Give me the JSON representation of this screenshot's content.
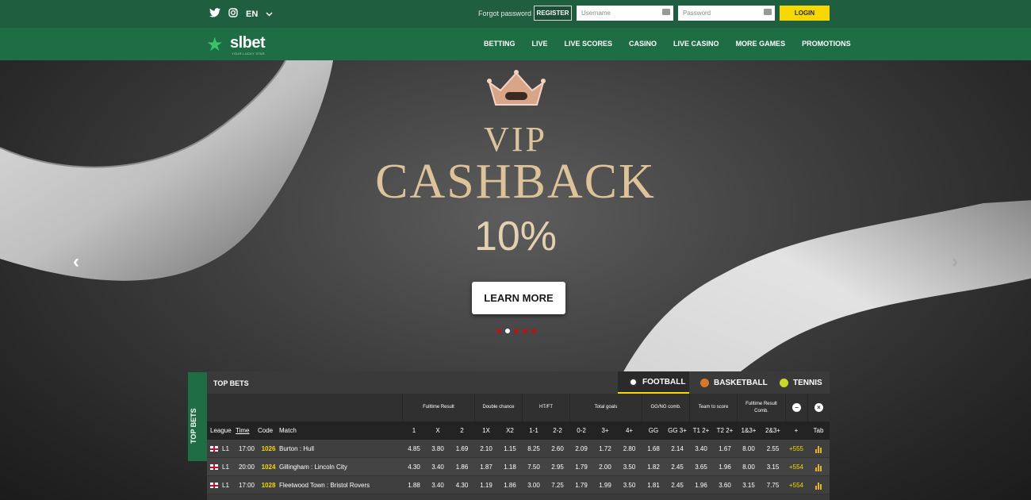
{
  "header": {
    "language": "EN",
    "forgot_password": "Forgot password",
    "register_label": "REGISTER",
    "username_placeholder": "Username",
    "password_placeholder": "Password",
    "login_label": "LOGIN"
  },
  "brand": {
    "name": "slbet",
    "tagline": "YOUR LUCKY STAR"
  },
  "nav": [
    "BETTING",
    "LIVE",
    "LIVE SCORES",
    "CASINO",
    "LIVE CASINO",
    "MORE GAMES",
    "PROMOTIONS"
  ],
  "banner": {
    "line1": "VIP",
    "line2": "CASHBACK",
    "line3": "10%",
    "cta": "LEARN MORE",
    "slides": 5,
    "active_slide": 1
  },
  "top_bets": {
    "side_label": "TOP BETS",
    "title": "TOP BETS",
    "sports": [
      {
        "label": "FOOTBALL",
        "icon": "football-icon",
        "active": true
      },
      {
        "label": "BASKETBALL",
        "icon": "basketball-icon",
        "active": false
      },
      {
        "label": "TENNIS",
        "icon": "tennis-icon",
        "active": false
      }
    ],
    "groups": [
      "Fulltime Result",
      "Double chance",
      "HT/FT",
      "Total goals",
      "GG/NG comb.",
      "Team to score",
      "Fulltime Result Comb."
    ],
    "columns": [
      "League",
      "Time",
      "Code",
      "Match",
      "1",
      "X",
      "2",
      "1X",
      "X2",
      "1-1",
      "2-2",
      "0-2",
      "3+",
      "4+",
      "GG",
      "GG 3+",
      "T1 2+",
      "T2 2+",
      "1&3+",
      "2&3+",
      "+",
      "Tab"
    ],
    "rows": [
      {
        "league": "L1",
        "time": "17:00",
        "code": "1026",
        "match": "Burton : Hull",
        "odds": [
          "4.85",
          "3.80",
          "1.69",
          "2.10",
          "1.15",
          "8.25",
          "2.60",
          "2.09",
          "1.72",
          "2.80",
          "1.68",
          "2.14",
          "3.40",
          "1.67",
          "8.00",
          "2.55"
        ],
        "more": "+555"
      },
      {
        "league": "L1",
        "time": "20:00",
        "code": "1024",
        "match": "Gillingham : Lincoln City",
        "odds": [
          "4.30",
          "3.40",
          "1.86",
          "1.87",
          "1.18",
          "7.50",
          "2.95",
          "1.79",
          "2.00",
          "3.50",
          "1.82",
          "2.45",
          "3.65",
          "1.96",
          "8.00",
          "3.15"
        ],
        "more": "+554"
      },
      {
        "league": "L1",
        "time": "17:00",
        "code": "1028",
        "match": "Fleetwood Town : Bristol Rovers",
        "odds": [
          "1.88",
          "3.40",
          "4.30",
          "1.19",
          "1.86",
          "3.00",
          "7.25",
          "1.79",
          "1.99",
          "3.50",
          "1.81",
          "2.45",
          "1.96",
          "3.60",
          "3.15",
          "7.75"
        ],
        "more": "+554"
      }
    ]
  },
  "colors": {
    "green_dark": "#1f5e3e",
    "green_nav": "#1e6d45",
    "yellow": "#f5d800",
    "gold_text": "#dcc39b"
  }
}
